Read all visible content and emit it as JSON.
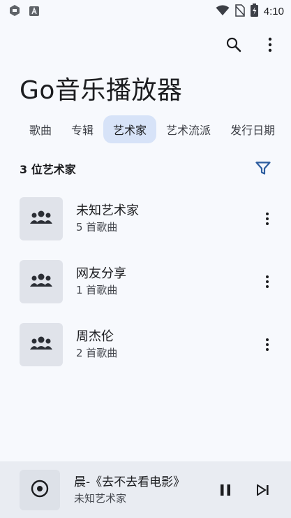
{
  "status_bar": {
    "time": "4:10",
    "left_icons": [
      "app-notification-icon",
      "accessibility-a-icon"
    ],
    "right_icons": [
      "wifi-icon",
      "no-sim-icon",
      "battery-charging-icon"
    ]
  },
  "header": {
    "title": "Go音乐播放器",
    "actions": [
      "search-icon",
      "more-vert-icon"
    ]
  },
  "tabs": [
    {
      "label": "歌曲",
      "active": false
    },
    {
      "label": "专辑",
      "active": false
    },
    {
      "label": "艺术家",
      "active": true
    },
    {
      "label": "艺术流派",
      "active": false
    },
    {
      "label": "发行日期",
      "active": false
    }
  ],
  "count_label": "3 位艺术家",
  "artists": [
    {
      "name": "未知艺术家",
      "songs": "5 首歌曲"
    },
    {
      "name": "网友分享",
      "songs": "1 首歌曲"
    },
    {
      "name": "周杰伦",
      "songs": "2 首歌曲"
    }
  ],
  "mini_player": {
    "title": "晨-《去不去看电影》",
    "artist": "未知艺术家"
  },
  "colors": {
    "background": "#f7f9fd",
    "active_tab": "#d7e3f8",
    "accent": "#2d5d9f",
    "mini_player_bg": "#e9ecf2"
  }
}
